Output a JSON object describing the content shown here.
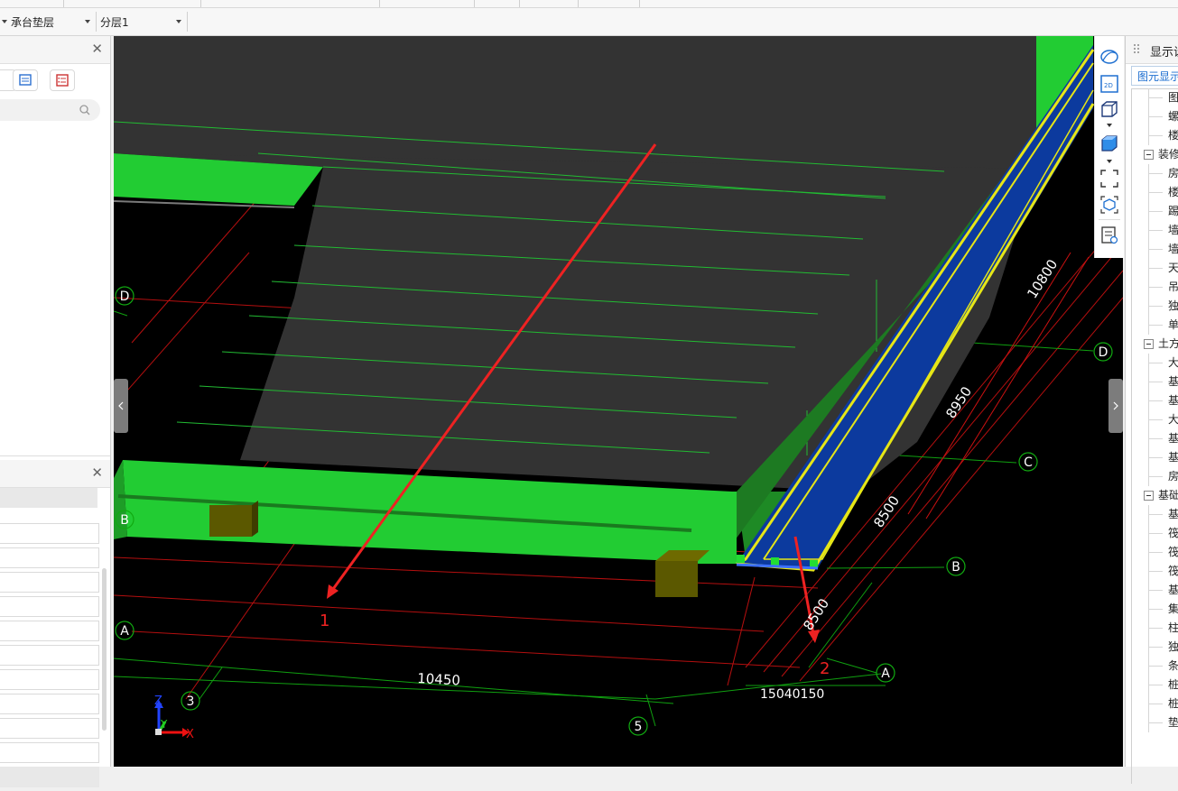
{
  "toolbar": {
    "layer_combo": "承台垫层",
    "sublayer_combo": "分层1"
  },
  "axis_labels": {
    "rows": [
      "A",
      "B",
      "C",
      "D"
    ],
    "cols": [
      "3",
      "5"
    ]
  },
  "dimensions": {
    "bottom_span": "10450",
    "right_1": "10800",
    "right_2": "8950",
    "right_3": "8500",
    "right_4": "8500",
    "small_overlap": "15040150"
  },
  "annotations": {
    "arrow_1": "1",
    "arrow_2": "2"
  },
  "axes_gizmo": {
    "z": "Z",
    "y": "Y",
    "x": "X"
  },
  "right_panel": {
    "title": "显示设",
    "tab": "图元显示",
    "tree": [
      {
        "type": "item",
        "label": "图"
      },
      {
        "type": "item",
        "label": "螺"
      },
      {
        "type": "item",
        "label": "楼"
      },
      {
        "type": "group",
        "label": "装修"
      },
      {
        "type": "item",
        "label": "房"
      },
      {
        "type": "item",
        "label": "楼"
      },
      {
        "type": "item",
        "label": "踢"
      },
      {
        "type": "item",
        "label": "墙"
      },
      {
        "type": "item",
        "label": "墙"
      },
      {
        "type": "item",
        "label": "天"
      },
      {
        "type": "item",
        "label": "吊"
      },
      {
        "type": "item",
        "label": "独"
      },
      {
        "type": "item",
        "label": "单"
      },
      {
        "type": "group",
        "label": "土方"
      },
      {
        "type": "item",
        "label": "大"
      },
      {
        "type": "item",
        "label": "基"
      },
      {
        "type": "item",
        "label": "基"
      },
      {
        "type": "item",
        "label": "大"
      },
      {
        "type": "item",
        "label": "基"
      },
      {
        "type": "item",
        "label": "基"
      },
      {
        "type": "item",
        "label": "房"
      },
      {
        "type": "group",
        "label": "基础"
      },
      {
        "type": "item",
        "label": "基"
      },
      {
        "type": "item",
        "label": "筏"
      },
      {
        "type": "item",
        "label": "筏"
      },
      {
        "type": "item",
        "label": "筏"
      },
      {
        "type": "item",
        "label": "基"
      },
      {
        "type": "item",
        "label": "集"
      },
      {
        "type": "item",
        "label": "柱"
      },
      {
        "type": "item",
        "label": "独"
      },
      {
        "type": "item",
        "label": "条"
      },
      {
        "type": "item",
        "label": "桩"
      },
      {
        "type": "item",
        "label": "桩"
      },
      {
        "type": "item",
        "label": "垫"
      }
    ]
  },
  "view_tools": [
    "orbit-icon",
    "view-2d-icon",
    "view-3d-box-icon",
    "view-solid-box-icon",
    "fit-view-icon",
    "select-3d-icon",
    "properties-view-icon"
  ],
  "colors": {
    "slab": "#333333",
    "green": "#22cc33",
    "blue": "#0c3a9e",
    "yellow": "#e6e617",
    "axis_red": "#cc1111",
    "axis_green": "#11aa11"
  }
}
